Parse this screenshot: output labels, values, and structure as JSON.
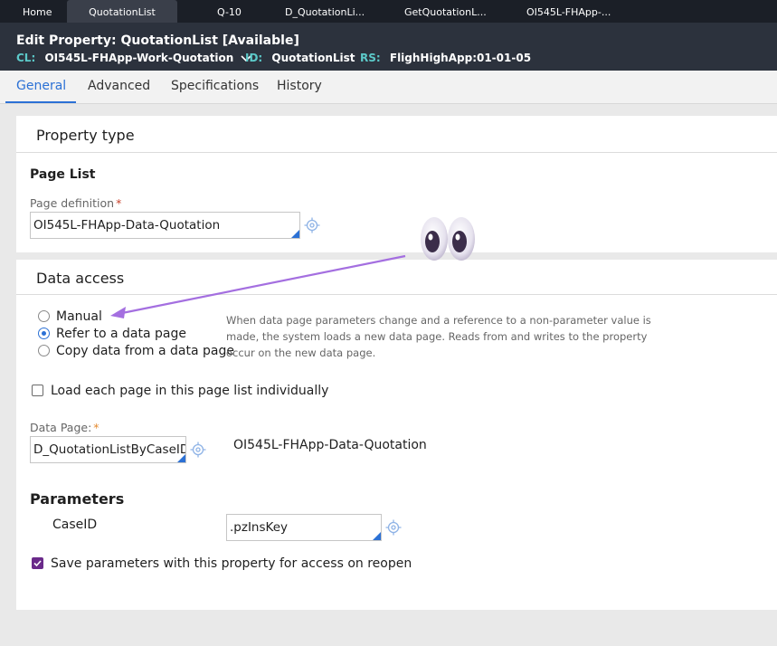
{
  "top_tabs": [
    "Home",
    "QuotationList",
    "Q-10",
    "D_QuotationLi...",
    "GetQuotationL...",
    "OI545L-FHApp-..."
  ],
  "header": {
    "title_prefix": "Edit  Property:",
    "title_name": "QuotationList",
    "title_status": "[Available]",
    "cl_label": "CL:",
    "cl_value": "OI545L-FHApp-Work-Quotation",
    "id_label": "ID:",
    "id_value": "QuotationList",
    "rs_label": "RS:",
    "rs_value": "FlighHighApp:01-01-05"
  },
  "sub_tabs": [
    "General",
    "Advanced",
    "Specifications",
    "History"
  ],
  "property_type": {
    "title": "Property type",
    "mode": "Page List",
    "page_definition_label": "Page definition",
    "required_mark": "*",
    "page_definition_value": "OI545L-FHApp-Data-Quotation"
  },
  "data_access": {
    "title": "Data access",
    "options": [
      "Manual",
      "Refer to a data page",
      "Copy data from a data page"
    ],
    "selected": "Refer to a data page",
    "help_text": "When data page parameters change and a reference to a non-parameter value is made, the system loads a new data page. Reads from and writes to the property occur on the new data page.",
    "load_each_label": "Load each page in this page list individually",
    "load_each_checked": false,
    "data_page_label": "Data Page:",
    "required_mark": "*",
    "data_page_value": "D_QuotationListByCaseID",
    "data_page_class": "OI545L-FHApp-Data-Quotation",
    "parameters_title": "Parameters",
    "param_name": "CaseID",
    "param_value": ".pzInsKey",
    "save_params_label": "Save parameters with this property for access on reopen",
    "save_params_checked": true
  },
  "colors": {
    "accent": "#2c71d5",
    "header_bg": "#2c323d",
    "topbar_bg": "#1b1f27",
    "label_teal": "#5cc9c9",
    "checkbox_purple": "#6a2a8a",
    "annotation_arrow": "#a46fe0"
  },
  "icons": [
    "chevron-down-icon",
    "target-icon",
    "eyes-emoji-icon",
    "arrow-annotation-icon"
  ]
}
